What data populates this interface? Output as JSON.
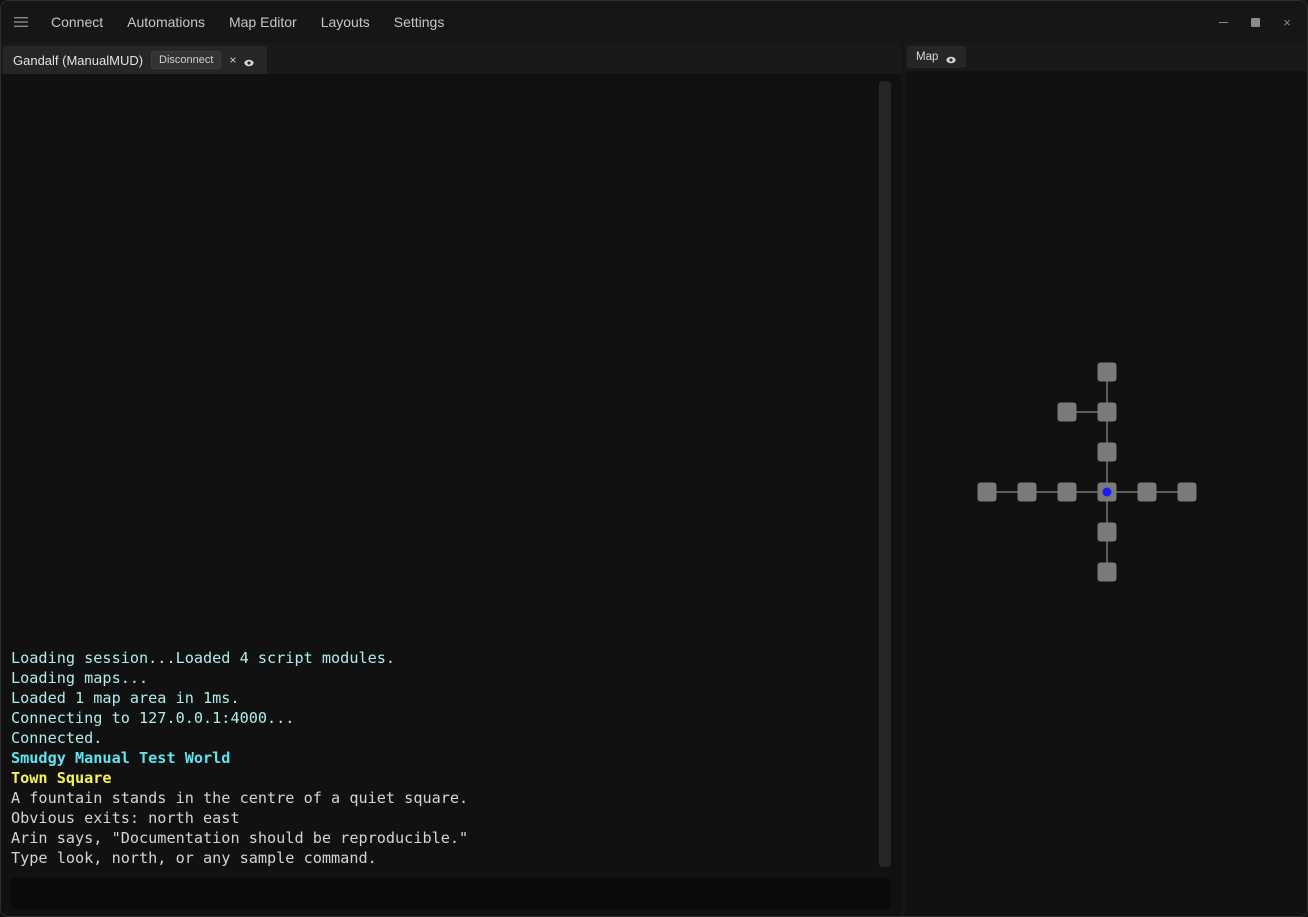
{
  "menubar": {
    "items": [
      {
        "label": "Connect"
      },
      {
        "label": "Automations"
      },
      {
        "label": "Map Editor"
      },
      {
        "label": "Layouts"
      },
      {
        "label": "Settings"
      }
    ],
    "window_controls": {
      "minimize": "−",
      "maximize": "■",
      "close": "×"
    }
  },
  "session_tab": {
    "title": "Gandalf (ManualMUD)",
    "disconnect_label": "Disconnect",
    "close_glyph": "×",
    "visibility_icon": "eye-icon"
  },
  "output": {
    "lines": [
      {
        "text": "Loading session...Loaded 4 script modules.",
        "color": "#b0ecec"
      },
      {
        "text": "Loading maps...",
        "color": "#b0ecec"
      },
      {
        "text": "Loaded 1 map area in 1ms.",
        "color": "#b0ecec"
      },
      {
        "text": "Connecting to 127.0.0.1:4000...",
        "color": "#b0ecec"
      },
      {
        "text": "Connected.",
        "color": "#b0ecec"
      },
      {
        "text": "Smudgy Manual Test World",
        "color": "#5ee6ee",
        "bold": true
      },
      {
        "text": "Town Square",
        "color": "#f4f45a",
        "bold": true
      },
      {
        "text": "A fountain stands in the centre of a quiet square.",
        "color": "#d4d4d4"
      },
      {
        "text": "Obvious exits: north east",
        "color": "#d4d4d4"
      },
      {
        "text": "Arin says, \"Documentation should be reproducible.\"",
        "color": "#d4d4d4"
      },
      {
        "text": "Type look, north, or any sample command.",
        "color": "#d4d4d4"
      }
    ]
  },
  "command_input": {
    "value": "",
    "placeholder": ""
  },
  "map_panel": {
    "tab_label": "Map",
    "visibility_icon": "eye-icon",
    "current_room_color": "#1a1aff",
    "room_color": "#7a7a7a",
    "exit_color": "#a8a8a8",
    "rooms": [
      {
        "id": "n3",
        "gx": 0,
        "gy": -3
      },
      {
        "id": "n2",
        "gx": 0,
        "gy": -2
      },
      {
        "id": "n2w",
        "gx": -1,
        "gy": -2
      },
      {
        "id": "n1",
        "gx": 0,
        "gy": -1
      },
      {
        "id": "c",
        "gx": 0,
        "gy": 0,
        "current": true
      },
      {
        "id": "w1",
        "gx": -1,
        "gy": 0
      },
      {
        "id": "w2",
        "gx": -2,
        "gy": 0
      },
      {
        "id": "w3",
        "gx": -3,
        "gy": 0
      },
      {
        "id": "e1",
        "gx": 1,
        "gy": 0
      },
      {
        "id": "e2",
        "gx": 2,
        "gy": 0
      },
      {
        "id": "s1",
        "gx": 0,
        "gy": 1
      },
      {
        "id": "s2",
        "gx": 0,
        "gy": 2
      }
    ],
    "exits": [
      [
        "n3",
        "n2"
      ],
      [
        "n2",
        "n2w"
      ],
      [
        "n2",
        "n1"
      ],
      [
        "n1",
        "c"
      ],
      [
        "c",
        "w1"
      ],
      [
        "w1",
        "w2"
      ],
      [
        "w2",
        "w3"
      ],
      [
        "c",
        "e1"
      ],
      [
        "e1",
        "e2"
      ],
      [
        "c",
        "s1"
      ],
      [
        "s1",
        "s2"
      ]
    ]
  }
}
